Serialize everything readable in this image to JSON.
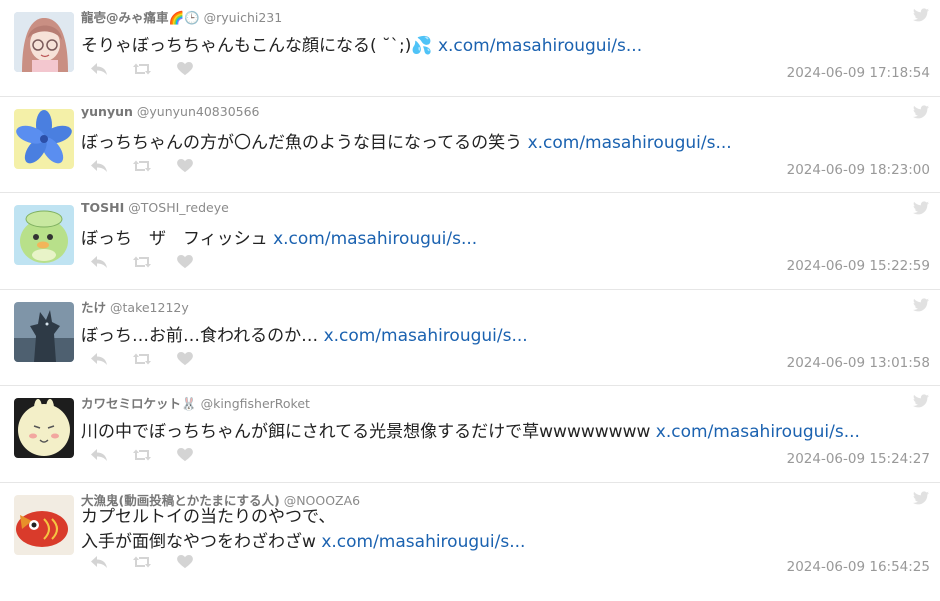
{
  "tweets": [
    {
      "name": "龍壱@みゃ痛車🌈🕒",
      "handle": "@ryuichi231",
      "text": "そりゃぼっちちゃんもこんな顔になる( ˘`;)💦",
      "link": "x.com/masahirougui/s...",
      "timestamp": "2024-06-09 17:18:54",
      "avatar_icon": "anime-girl-avatar"
    },
    {
      "name": "yunyun",
      "handle": "@yunyun40830566",
      "text": "ぼっちちゃんの方が〇んだ魚のような目になってるの笑う",
      "link": "x.com/masahirougui/s...",
      "timestamp": "2024-06-09 18:23:00",
      "avatar_icon": "blue-flower-avatar"
    },
    {
      "name": "TOSHI",
      "handle": "@TOSHI_redeye",
      "text": "ぼっち　ザ　フィッシュ",
      "link": "x.com/masahirougui/s...",
      "timestamp": "2024-06-09 15:22:59",
      "avatar_icon": "green-frog-avatar"
    },
    {
      "name": "たけ",
      "handle": "@take1212y",
      "text": "ぼっち…お前…食われるのか…",
      "link": "x.com/masahirougui/s...",
      "timestamp": "2024-06-09 13:01:58",
      "avatar_icon": "monster-avatar"
    },
    {
      "name": "カワセミロケット🐰",
      "handle": "@kingfisherRoket",
      "text": "川の中でぼっちちゃんが餌にされてる光景想像するだけで草wwwwwwww",
      "link": "x.com/masahirougui/s...",
      "timestamp": "2024-06-09 15:24:27",
      "avatar_icon": "rabbit-avatar"
    },
    {
      "name": "大漁鬼(動画投稿とかたまにする人)",
      "handle": "@NOOOZA6",
      "text_line1": "カプセルトイの当たりのやつで、",
      "text": "入手が面倒なやつをわざわざw",
      "link": "x.com/masahirougui/s...",
      "timestamp": "2024-06-09 16:54:25",
      "avatar_icon": "red-fish-avatar"
    }
  ],
  "colors": {
    "link": "#1b62b0",
    "name": "#777777",
    "timestamp": "#999999",
    "icon": "#d4d4d4"
  }
}
